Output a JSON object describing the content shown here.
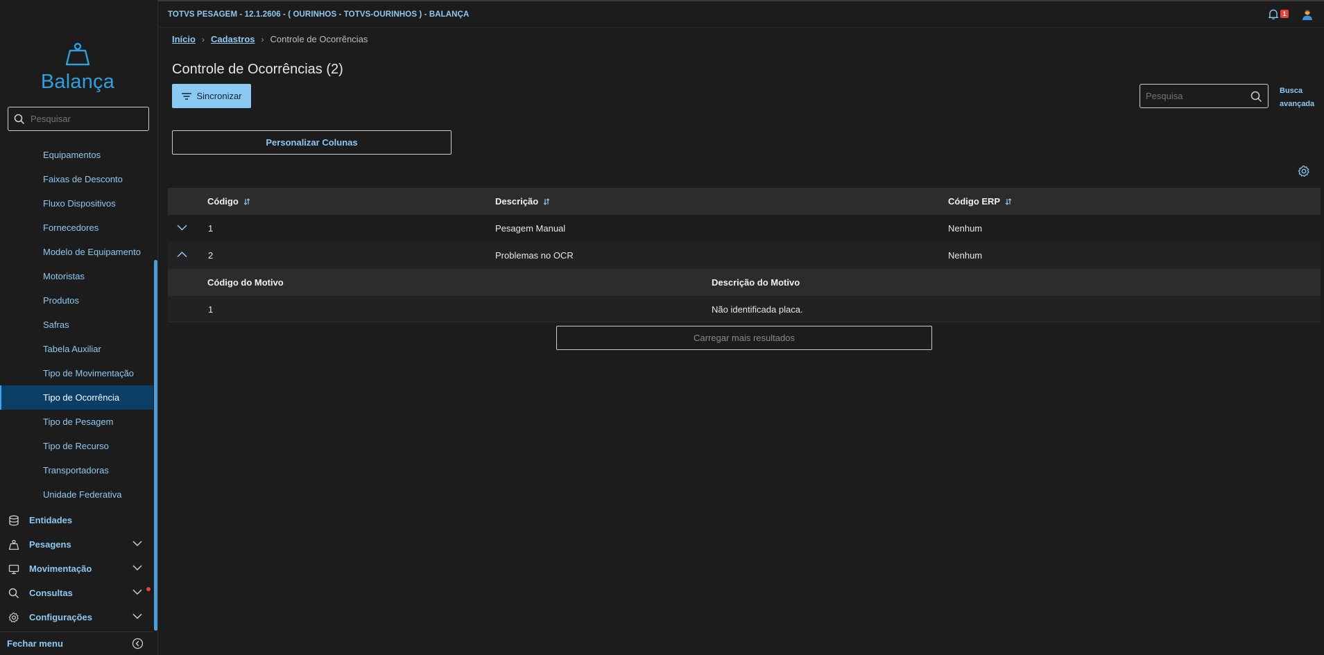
{
  "header": {
    "app_title": "TOTVS PESAGEM - 12.1.2606 - ( OURINHOS - TOTVS-OURINHOS ) - BALANÇA",
    "notification_count": "1"
  },
  "sidebar": {
    "logo_text": "Balança",
    "search_placeholder": "Pesquisar",
    "items": [
      {
        "label": "Equipamentos"
      },
      {
        "label": "Faixas de Desconto"
      },
      {
        "label": "Fluxo Dispositivos"
      },
      {
        "label": "Fornecedores"
      },
      {
        "label": "Modelo de Equipamento"
      },
      {
        "label": "Motoristas"
      },
      {
        "label": "Produtos"
      },
      {
        "label": "Safras"
      },
      {
        "label": "Tabela Auxiliar"
      },
      {
        "label": "Tipo de Movimentação"
      },
      {
        "label": "Tipo de Ocorrência"
      },
      {
        "label": "Tipo de Pesagem"
      },
      {
        "label": "Tipo de Recurso"
      },
      {
        "label": "Transportadoras"
      },
      {
        "label": "Unidade Federativa"
      }
    ],
    "active_item": "Tipo de Ocorrência",
    "groups": [
      {
        "label": "Entidades"
      },
      {
        "label": "Pesagens"
      },
      {
        "label": "Movimentação"
      },
      {
        "label": "Consultas"
      },
      {
        "label": "Configurações"
      }
    ],
    "footer_label": "Fechar menu"
  },
  "breadcrumb": {
    "home": "Início",
    "section": "Cadastros",
    "current": "Controle de Ocorrências"
  },
  "page": {
    "title": "Controle de Ocorrências (2)",
    "sync_label": "Sincronizar",
    "search_placeholder": "Pesquisa",
    "advanced_search": "Busca avançada",
    "customize_columns": "Personalizar Colunas",
    "load_more": "Carregar mais resultados"
  },
  "table": {
    "columns": [
      "Código",
      "Descrição",
      "Código ERP"
    ],
    "rows": [
      {
        "codigo": "1",
        "descricao": "Pesagem Manual",
        "erp": "Nenhum"
      },
      {
        "codigo": "2",
        "descricao": "Problemas no OCR",
        "erp": "Nenhum"
      }
    ],
    "detail": {
      "columns": [
        "Código do Motivo",
        "Descrição do Motivo"
      ],
      "rows": [
        {
          "codigo": "1",
          "descricao": "Não identificada placa."
        }
      ]
    }
  },
  "colors": {
    "accent": "#2f9fe0",
    "link": "#8fc8f0",
    "active_bg": "#0a3e66",
    "primary_button": "#8cc9f2",
    "badge": "#e0443e"
  }
}
